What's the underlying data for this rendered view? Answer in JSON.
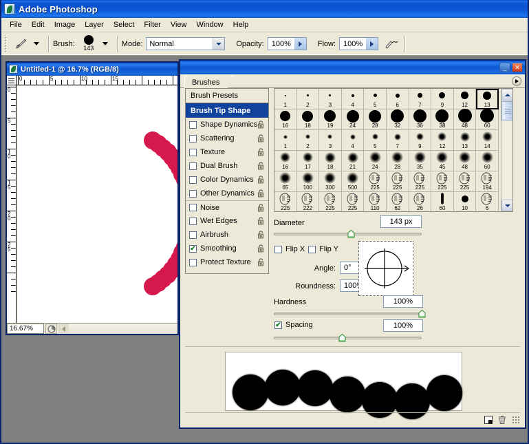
{
  "app": {
    "title": "Adobe Photoshop",
    "icon": "photoshop-icon"
  },
  "menubar": {
    "items": [
      "File",
      "Edit",
      "Image",
      "Layer",
      "Select",
      "Filter",
      "View",
      "Window",
      "Help"
    ]
  },
  "options_bar": {
    "tool_icon": "brush-tool-icon",
    "brush_label": "Brush:",
    "brush_size": "143",
    "mode_label": "Mode:",
    "mode_value": "Normal",
    "opacity_label": "Opacity:",
    "opacity_value": "100%",
    "flow_label": "Flow:",
    "flow_value": "100%",
    "airbrush_icon": "airbrush-icon"
  },
  "document": {
    "title": "Untitled-1 @ 16.7% (RGB/8)",
    "zoom": "16.67%",
    "ruler_h_labels": [
      "0",
      "5",
      "10",
      "15"
    ],
    "ruler_v_labels": [
      "0",
      "5",
      "10",
      "15",
      "20",
      "25"
    ],
    "artwork": {
      "brush_color": "#d6194c",
      "description": "red brush stroke arc of dots"
    }
  },
  "brushes_panel": {
    "tab_label": "Brushes",
    "minimize_label": "_",
    "close_label": "✕",
    "menu_icon": "panel-menu-icon",
    "sidebar": {
      "presets_label": "Brush Presets",
      "selected": "Brush Tip Shape",
      "items": [
        {
          "label": "Brush Tip Shape",
          "checked": null,
          "selected": true
        },
        {
          "label": "Shape Dynamics",
          "checked": false
        },
        {
          "label": "Scattering",
          "checked": false
        },
        {
          "label": "Texture",
          "checked": false
        },
        {
          "label": "Dual Brush",
          "checked": false
        },
        {
          "label": "Color Dynamics",
          "checked": false
        },
        {
          "label": "Other Dynamics",
          "checked": false
        },
        {
          "label": "Noise",
          "checked": false,
          "divider": true
        },
        {
          "label": "Wet Edges",
          "checked": false
        },
        {
          "label": "Airbrush",
          "checked": false
        },
        {
          "label": "Smoothing",
          "checked": true
        },
        {
          "label": "Protect Texture",
          "checked": false
        }
      ]
    },
    "brush_grid": {
      "selected_index": 9,
      "rows": [
        {
          "kind": "hard",
          "cells": [
            {
              "num": "1",
              "size": 2
            },
            {
              "num": "2",
              "size": 3
            },
            {
              "num": "3",
              "size": 3
            },
            {
              "num": "4",
              "size": 4
            },
            {
              "num": "5",
              "size": 5
            },
            {
              "num": "6",
              "size": 6
            },
            {
              "num": "7",
              "size": 7
            },
            {
              "num": "9",
              "size": 9
            },
            {
              "num": "12",
              "size": 11
            },
            {
              "num": "13",
              "size": 12
            }
          ]
        },
        {
          "kind": "hard",
          "cells": [
            {
              "num": "16",
              "size": 15
            },
            {
              "num": "18",
              "size": 16
            },
            {
              "num": "19",
              "size": 17
            },
            {
              "num": "24",
              "size": 18
            },
            {
              "num": "28",
              "size": 18
            },
            {
              "num": "32",
              "size": 19
            },
            {
              "num": "36",
              "size": 19
            },
            {
              "num": "38",
              "size": 19
            },
            {
              "num": "48",
              "size": 20
            },
            {
              "num": "60",
              "size": 20
            }
          ]
        },
        {
          "kind": "soft",
          "cells": [
            {
              "num": "1",
              "size": 2
            },
            {
              "num": "2",
              "size": 3
            },
            {
              "num": "3",
              "size": 3
            },
            {
              "num": "4",
              "size": 4
            },
            {
              "num": "5",
              "size": 5
            },
            {
              "num": "7",
              "size": 6
            },
            {
              "num": "9",
              "size": 7
            },
            {
              "num": "12",
              "size": 9
            },
            {
              "num": "13",
              "size": 10
            },
            {
              "num": "14",
              "size": 11
            }
          ]
        },
        {
          "kind": "soft",
          "cells": [
            {
              "num": "16",
              "size": 11
            },
            {
              "num": "17",
              "size": 11
            },
            {
              "num": "18",
              "size": 12
            },
            {
              "num": "21",
              "size": 12
            },
            {
              "num": "24",
              "size": 13
            },
            {
              "num": "28",
              "size": 13
            },
            {
              "num": "35",
              "size": 13
            },
            {
              "num": "45",
              "size": 13
            },
            {
              "num": "48",
              "size": 13
            },
            {
              "num": "60",
              "size": 13
            }
          ]
        },
        {
          "kind": "mixed",
          "cells": [
            {
              "num": "65",
              "size": 13,
              "art": "soft"
            },
            {
              "num": "100",
              "size": 13,
              "art": "soft"
            },
            {
              "num": "300",
              "size": 13,
              "art": "soft"
            },
            {
              "num": "500",
              "size": 13,
              "art": "soft"
            },
            {
              "num": "225",
              "art": "texture"
            },
            {
              "num": "225",
              "art": "texture"
            },
            {
              "num": "225",
              "art": "texture"
            },
            {
              "num": "225",
              "art": "texture"
            },
            {
              "num": "225",
              "art": "texture"
            },
            {
              "num": "194",
              "art": "texture"
            }
          ]
        },
        {
          "kind": "mixed",
          "cells": [
            {
              "num": "225",
              "art": "texture"
            },
            {
              "num": "222",
              "art": "texture"
            },
            {
              "num": "225",
              "art": "texture"
            },
            {
              "num": "225",
              "art": "texture"
            },
            {
              "num": "110",
              "art": "texture"
            },
            {
              "num": "62",
              "art": "texture"
            },
            {
              "num": "26",
              "art": "texture"
            },
            {
              "num": "60",
              "art": "bar"
            },
            {
              "num": "10",
              "size": 10,
              "art": "hard"
            },
            {
              "num": "6",
              "art": "texture"
            }
          ]
        }
      ]
    },
    "controls": {
      "diameter_label": "Diameter",
      "diameter_value": "143 px",
      "diameter_pct": 52,
      "flip_x_label": "Flip X",
      "flip_x_checked": false,
      "flip_y_label": "Flip Y",
      "flip_y_checked": false,
      "angle_label": "Angle:",
      "angle_value": "0°",
      "roundness_label": "Roundness:",
      "roundness_value": "100%",
      "hardness_label": "Hardness",
      "hardness_value": "100%",
      "hardness_pct": 100,
      "spacing_label": "Spacing",
      "spacing_checked": true,
      "spacing_value": "100%",
      "spacing_pct": 46
    },
    "stroke_preview": {
      "dot_color": "#000000",
      "dots": 7
    },
    "footer": {
      "new_brush_icon": "new-brush-icon",
      "delete_brush_icon": "trash-icon",
      "resize_grip": "resize-grip"
    }
  }
}
